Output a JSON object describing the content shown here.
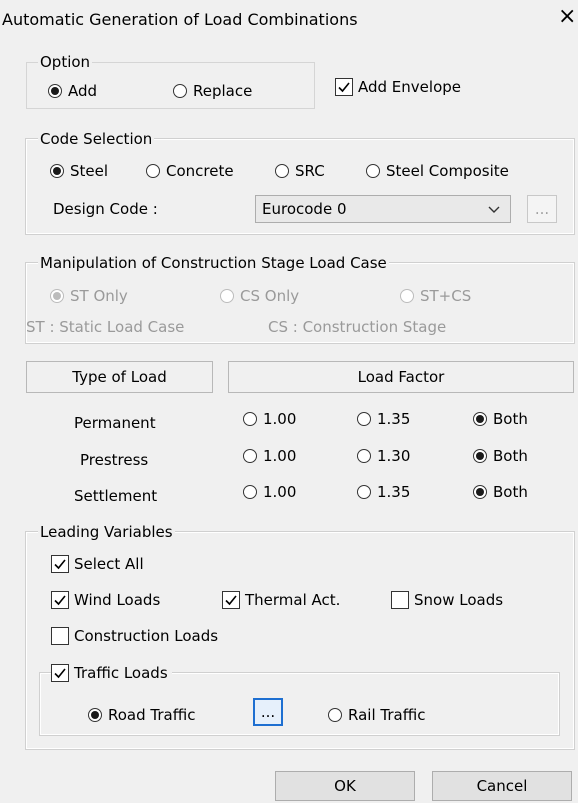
{
  "dialog": {
    "title": "Automatic Generation of Load Combinations",
    "close_glyph": "×"
  },
  "option": {
    "legend": "Option",
    "add": "Add",
    "replace": "Replace",
    "envelope": "Add Envelope"
  },
  "code": {
    "legend": "Code Selection",
    "steel": "Steel",
    "concrete": "Concrete",
    "src": "SRC",
    "composite": "Steel Composite",
    "design_label": "Design Code :",
    "design_value": "Eurocode 0",
    "more": "..."
  },
  "stage": {
    "legend": "Manipulation of Construction Stage Load Case",
    "st_only": "ST Only",
    "cs_only": "CS Only",
    "st_cs": "ST+CS",
    "st_note": "ST : Static Load Case",
    "cs_note": "CS : Construction Stage"
  },
  "table": {
    "type_header": "Type of Load",
    "factor_header": "Load Factor",
    "rows": [
      {
        "name": "Permanent",
        "f1": "1.00",
        "f2": "1.35",
        "both": "Both"
      },
      {
        "name": "Prestress",
        "f1": "1.00",
        "f2": "1.30",
        "both": "Both"
      },
      {
        "name": "Settlement",
        "f1": "1.00",
        "f2": "1.35",
        "both": "Both"
      }
    ]
  },
  "leading": {
    "legend": "Leading Variables",
    "select_all": "Select All",
    "wind": "Wind Loads",
    "thermal": "Thermal Act.",
    "snow": "Snow Loads",
    "construction": "Construction Loads",
    "traffic": "Traffic Loads",
    "road": "Road Traffic",
    "rail": "Rail Traffic",
    "more": "..."
  },
  "buttons": {
    "ok": "OK",
    "cancel": "Cancel"
  }
}
